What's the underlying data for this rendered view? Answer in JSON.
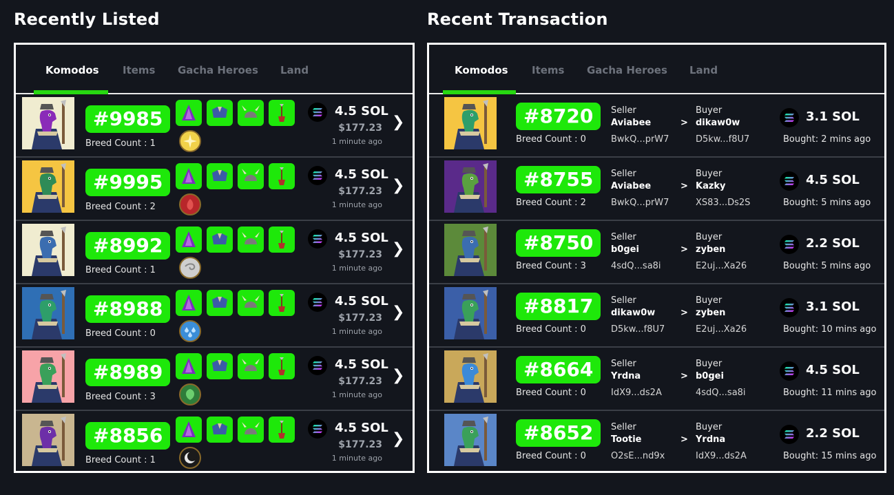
{
  "recently_listed": {
    "title": "Recently Listed",
    "tabs": [
      "Komodos",
      "Items",
      "Gacha Heroes",
      "Land"
    ],
    "active_tab": "Komodos",
    "rows": [
      {
        "id": "#9985",
        "breed": "Breed Count : 1",
        "sol": "4.5 SOL",
        "usd": "$177.23",
        "time": "1 minute ago",
        "element": "light",
        "bg": "#f0ecd0",
        "skin": "#8a2bb8"
      },
      {
        "id": "#9995",
        "breed": "Breed Count : 2",
        "sol": "4.5 SOL",
        "usd": "$177.23",
        "time": "1 minute ago",
        "element": "fire",
        "bg": "#f5c542",
        "skin": "#2e8b57"
      },
      {
        "id": "#8992",
        "breed": "Breed Count : 1",
        "sol": "4.5 SOL",
        "usd": "$177.23",
        "time": "1 minute ago",
        "element": "wind",
        "bg": "#f0ecd0",
        "skin": "#3b6db0"
      },
      {
        "id": "#8988",
        "breed": "Breed Count : 0",
        "sol": "4.5 SOL",
        "usd": "$177.23",
        "time": "1 minute ago",
        "element": "water",
        "bg": "#2f6fb5",
        "skin": "#2e9e6a"
      },
      {
        "id": "#8989",
        "breed": "Breed Count : 3",
        "sol": "4.5 SOL",
        "usd": "$177.23",
        "time": "1 minute ago",
        "element": "nature",
        "bg": "#f7a3a8",
        "skin": "#3aa05a"
      },
      {
        "id": "#8856",
        "breed": "Breed Count : 1",
        "sol": "4.5 SOL",
        "usd": "$177.23",
        "time": "1 minute ago",
        "element": "dark",
        "bg": "#c9b690",
        "skin": "#6d2fa8"
      }
    ]
  },
  "recent_transaction": {
    "title": "Recent Transaction",
    "tabs": [
      "Komodos",
      "Items",
      "Gacha Heroes",
      "Land"
    ],
    "active_tab": "Komodos",
    "seller_label": "Seller",
    "buyer_label": "Buyer",
    "arrow": ">",
    "rows": [
      {
        "id": "#8720",
        "breed": "Breed Count : 0",
        "seller": "Aviabee",
        "seller_addr": "BwkQ...prW7",
        "buyer": "dikaw0w",
        "buyer_addr": "D5kw...f8U7",
        "sol": "3.1 SOL",
        "bought": "Bought: 2 mins ago",
        "bg": "#f5c542",
        "skin": "#2e9e6a"
      },
      {
        "id": "#8755",
        "breed": "Breed Count : 2",
        "seller": "Aviabee",
        "seller_addr": "BwkQ...prW7",
        "buyer": "Kazky",
        "buyer_addr": "XS83...Ds2S",
        "sol": "4.5 SOL",
        "bought": "Bought: 5 mins ago",
        "bg": "#5a2a8a",
        "skin": "#5aa040"
      },
      {
        "id": "#8750",
        "breed": "Breed Count : 3",
        "seller": "b0gei",
        "seller_addr": "4sdQ...sa8i",
        "buyer": "zyben",
        "buyer_addr": "E2uj...Xa26",
        "sol": "2.2 SOL",
        "bought": "Bought: 5 mins ago",
        "bg": "#5c8a3a",
        "skin": "#3b6db0"
      },
      {
        "id": "#8817",
        "breed": "Breed Count : 0",
        "seller": "dikaw0w",
        "seller_addr": "D5kw...f8U7",
        "buyer": "zyben",
        "buyer_addr": "E2uj...Xa26",
        "sol": "3.1 SOL",
        "bought": "Bought: 10 mins ago",
        "bg": "#3b5fa8",
        "skin": "#3aa05a"
      },
      {
        "id": "#8664",
        "breed": "Breed Count : 0",
        "seller": "Yrdna",
        "seller_addr": "IdX9...ds2A",
        "buyer": "b0gei",
        "buyer_addr": "4sdQ...sa8i",
        "sol": "4.5 SOL",
        "bought": "Bought: 11 mins ago",
        "bg": "#c9a85a",
        "skin": "#3b8ad8"
      },
      {
        "id": "#8652",
        "breed": "Breed Count : 0",
        "seller": "Tootie",
        "seller_addr": "O2sE...nd9x",
        "buyer": "Yrdna",
        "buyer_addr": "IdX9...ds2A",
        "sol": "2.2 SOL",
        "bought": "Bought: 15 mins ago",
        "bg": "#5a86c8",
        "skin": "#3aa05a"
      }
    ]
  },
  "icons": {
    "sol": "solana-icon",
    "chevron": "chevron-right-icon"
  },
  "colors": {
    "accent_green": "#1ee80a",
    "background": "#13161d",
    "border": "#ffffff",
    "muted_text": "#9ea3ab"
  }
}
